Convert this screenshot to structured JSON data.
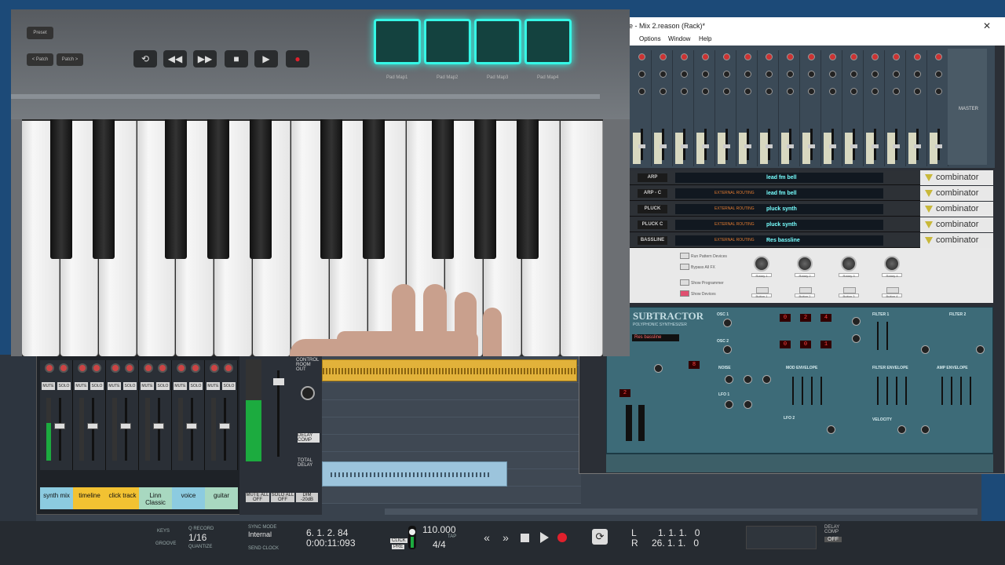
{
  "rack_window": {
    "title": "e - Mix 2.reason (Rack)*",
    "menu": [
      "Options",
      "Window",
      "Help"
    ],
    "mixer_label": "MASTER",
    "combinators": [
      {
        "name": "ARP",
        "patch": "lead fm bell",
        "ext": ""
      },
      {
        "name": "ARP - C",
        "patch": "lead fm bell",
        "ext": "EXTERNAL ROUTING"
      },
      {
        "name": "PLUCK",
        "patch": "pluck synth",
        "ext": "EXTERNAL ROUTING"
      },
      {
        "name": "PLUCK C",
        "patch": "pluck synth",
        "ext": "EXTERNAL ROUTING"
      },
      {
        "name": "BASSLINE",
        "patch": "Res bassline",
        "ext": "EXTERNAL ROUTING"
      }
    ],
    "combinator_logo": "combinator",
    "combinator_panel": {
      "buttons": [
        "Run Pattern Devices",
        "Bypass All FX",
        "Show Programmer",
        "Show Devices"
      ],
      "rotaries": [
        "Rotary 1",
        "Rotary 2",
        "Rotary 3",
        "Rotary 4"
      ],
      "button_labels": [
        "Button 1",
        "Button 2",
        "Button 3",
        "Button 4"
      ]
    },
    "subtractor": {
      "title": "SUBTRACTOR",
      "subtitle": "POLYPHONIC SYNTHESIZER",
      "patch": "Res bassline",
      "sections": [
        "OSC 1",
        "OSC 2",
        "NOISE",
        "LFO 1",
        "LFO 2",
        "MOD ENVELOPE",
        "FILTER 1",
        "FILTER 2",
        "FILTER ENVELOPE",
        "AMP ENVELOPE",
        "VELOCITY"
      ],
      "osc_values": [
        "0",
        "2",
        "4",
        "0",
        "0",
        "1"
      ],
      "polyphony": "8",
      "range": "2"
    }
  },
  "keyboard": {
    "buttons": [
      "Preset",
      "< Patch",
      "Patch >"
    ],
    "pad_labels": [
      "Pad Map1",
      "Pad Map2",
      "Pad Map3",
      "Pad Map4"
    ]
  },
  "mixer": {
    "channels": [
      {
        "name": "synth mix",
        "color": "#8ccbe0"
      },
      {
        "name": "timeline",
        "color": "#f2c232"
      },
      {
        "name": "click track",
        "color": "#f2c232"
      },
      {
        "name": "Linn Classic",
        "color": "#a8d8c0"
      },
      {
        "name": "voice",
        "color": "#8ccbe0"
      },
      {
        "name": "guitar",
        "color": "#a8d8c0"
      }
    ],
    "strip_buttons": [
      "MUTE",
      "SOLO"
    ],
    "control_room": "CONTROL ROOM OUT",
    "delay_comp": "DELAY COMP",
    "total_delay": "TOTAL DELAY",
    "master_btns": [
      "MUTE ALL OFF",
      "SOLO ALL OFF",
      "DIM -20dB"
    ]
  },
  "transport": {
    "quantize": "1/16",
    "quantize_label": "Q RECORD",
    "quantize_sub": "QUANTIZE",
    "sync_mode_label": "SYNC MODE",
    "sync_mode": "Internal",
    "send_clock": "SEND CLOCK",
    "position_bars": "6. 1. 2. 84",
    "position_time": "0:00:11:093",
    "tempo": "110.000",
    "tap": "TAP",
    "signature": "4/4",
    "click": "CLICK",
    "pre": "PRE",
    "loop_left_label": "L",
    "loop_left": "1. 1. 1.   0",
    "loop_right_label": "R",
    "loop_right": "26. 1. 1.   0",
    "onoff": "OFF",
    "onoff_label": "DELAY COMP",
    "keys_label": "KEYS",
    "groove_label": "GROOVE"
  }
}
